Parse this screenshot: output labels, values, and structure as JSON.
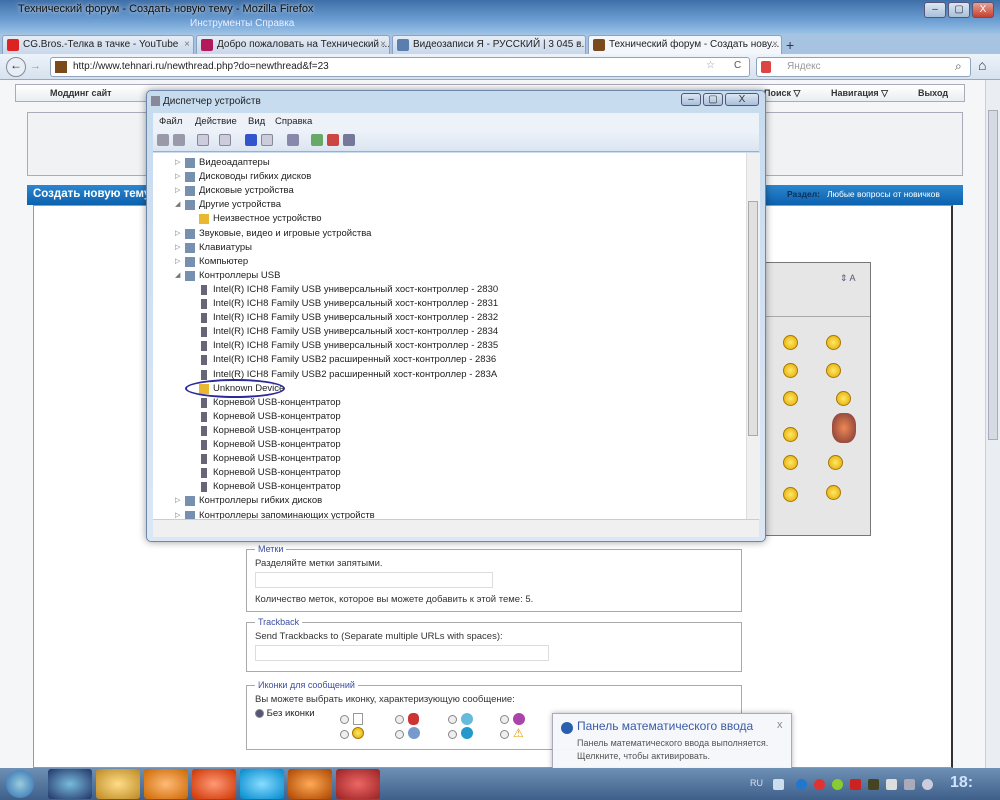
{
  "window": {
    "title": "Технический форум - Создать новую тему - Mozilla Firefox",
    "menu_ghost": "Инструменты  Справка",
    "min": "–",
    "max": "▢",
    "close": "X"
  },
  "tabs": [
    {
      "label": "CG.Bros.-Телка в тачке - YouTube",
      "color": "#d22"
    },
    {
      "label": "Добро пожаловать на Технический ...",
      "color": "#b2185a"
    },
    {
      "label": "Видеозаписи Я - РУССКИЙ | 3 045 в...",
      "color": "#5a7fae"
    },
    {
      "label": "Технический форум - Создать нову...",
      "color": "#7a4a1a"
    }
  ],
  "tab_close": "×",
  "new_tab": "+",
  "nav": {
    "back": "←",
    "forward": "→",
    "url": "http://www.tehnari.ru/newthread.php?do=newthread&f=23",
    "star": "☆",
    "reload": "C",
    "search_placeholder": "Яндекс",
    "search_icon": "⌕",
    "home": "⌂"
  },
  "forum": {
    "nav_items": [
      "Моддинг сайт",
      "Поиск ▽",
      "Навигация ▽",
      "Выход"
    ],
    "header_title": "Создать новую тему",
    "section_label": "Раздел:",
    "section_value": "Любые вопросы от новичков"
  },
  "device_manager": {
    "title": "Диспетчер устройств",
    "menu": [
      "Файл",
      "Действие",
      "Вид",
      "Справка"
    ],
    "tree": [
      {
        "level": 0,
        "label": "Видеоадаптеры",
        "expander": "▷"
      },
      {
        "level": 0,
        "label": "Дисководы гибких дисков",
        "expander": "▷"
      },
      {
        "level": 0,
        "label": "Дисковые устройства",
        "expander": "▷"
      },
      {
        "level": 0,
        "label": "Другие устройства",
        "expander": "◢"
      },
      {
        "level": 1,
        "label": "Неизвестное устройство",
        "warn": true
      },
      {
        "level": 0,
        "label": "Звуковые, видео и игровые устройства",
        "expander": "▷"
      },
      {
        "level": 0,
        "label": "Клавиатуры",
        "expander": "▷"
      },
      {
        "level": 0,
        "label": "Компьютер",
        "expander": "▷"
      },
      {
        "level": 0,
        "label": "Контроллеры USB",
        "expander": "◢"
      },
      {
        "level": 1,
        "label": "Intel(R) ICH8 Family USB универсальный хост-контроллер  - 2830"
      },
      {
        "level": 1,
        "label": "Intel(R) ICH8 Family USB универсальный хост-контроллер  - 2831"
      },
      {
        "level": 1,
        "label": "Intel(R) ICH8 Family USB универсальный хост-контроллер  - 2832"
      },
      {
        "level": 1,
        "label": "Intel(R) ICH8 Family USB универсальный хост-контроллер  - 2834"
      },
      {
        "level": 1,
        "label": "Intel(R) ICH8 Family USB универсальный хост-контроллер  - 2835"
      },
      {
        "level": 1,
        "label": "Intel(R) ICH8 Family USB2 расширенный хост-контроллер  - 2836"
      },
      {
        "level": 1,
        "label": "Intel(R) ICH8 Family USB2 расширенный хост-контроллер  - 283A"
      },
      {
        "level": 1,
        "label": "Unknown Device",
        "warn": true,
        "circled": true
      },
      {
        "level": 1,
        "label": "Корневой USB-концентратор"
      },
      {
        "level": 1,
        "label": "Корневой USB-концентратор"
      },
      {
        "level": 1,
        "label": "Корневой USB-концентратор"
      },
      {
        "level": 1,
        "label": "Корневой USB-концентратор"
      },
      {
        "level": 1,
        "label": "Корневой USB-концентратор"
      },
      {
        "level": 1,
        "label": "Корневой USB-концентратор"
      },
      {
        "level": 1,
        "label": "Корневой USB-концентратор"
      },
      {
        "level": 0,
        "label": "Контроллеры гибких дисков",
        "expander": "▷"
      },
      {
        "level": 0,
        "label": "Контроллеры запоминающих устройств",
        "expander": "▷"
      }
    ]
  },
  "tags": {
    "legend": "Метки",
    "hint": "Разделяйте метки запятыми.",
    "limit": "Количество меток, которое вы можете добавить к этой теме: 5."
  },
  "trackback": {
    "legend": "Trackback",
    "label": "Send Trackbacks to (Separate multiple URLs with spaces):"
  },
  "icons": {
    "legend": "Иконки для сообщений",
    "hint": "Вы можете выбрать иконку, характеризующую сообщение:",
    "none_label": "Без иконки"
  },
  "notification": {
    "title": "Панель математического ввода",
    "line1": "Панель математического ввода выполняется.",
    "line2": "Щелкните, чтобы активировать.",
    "close": "x"
  },
  "taskbar": {
    "lang": "RU",
    "clock": "18:"
  }
}
